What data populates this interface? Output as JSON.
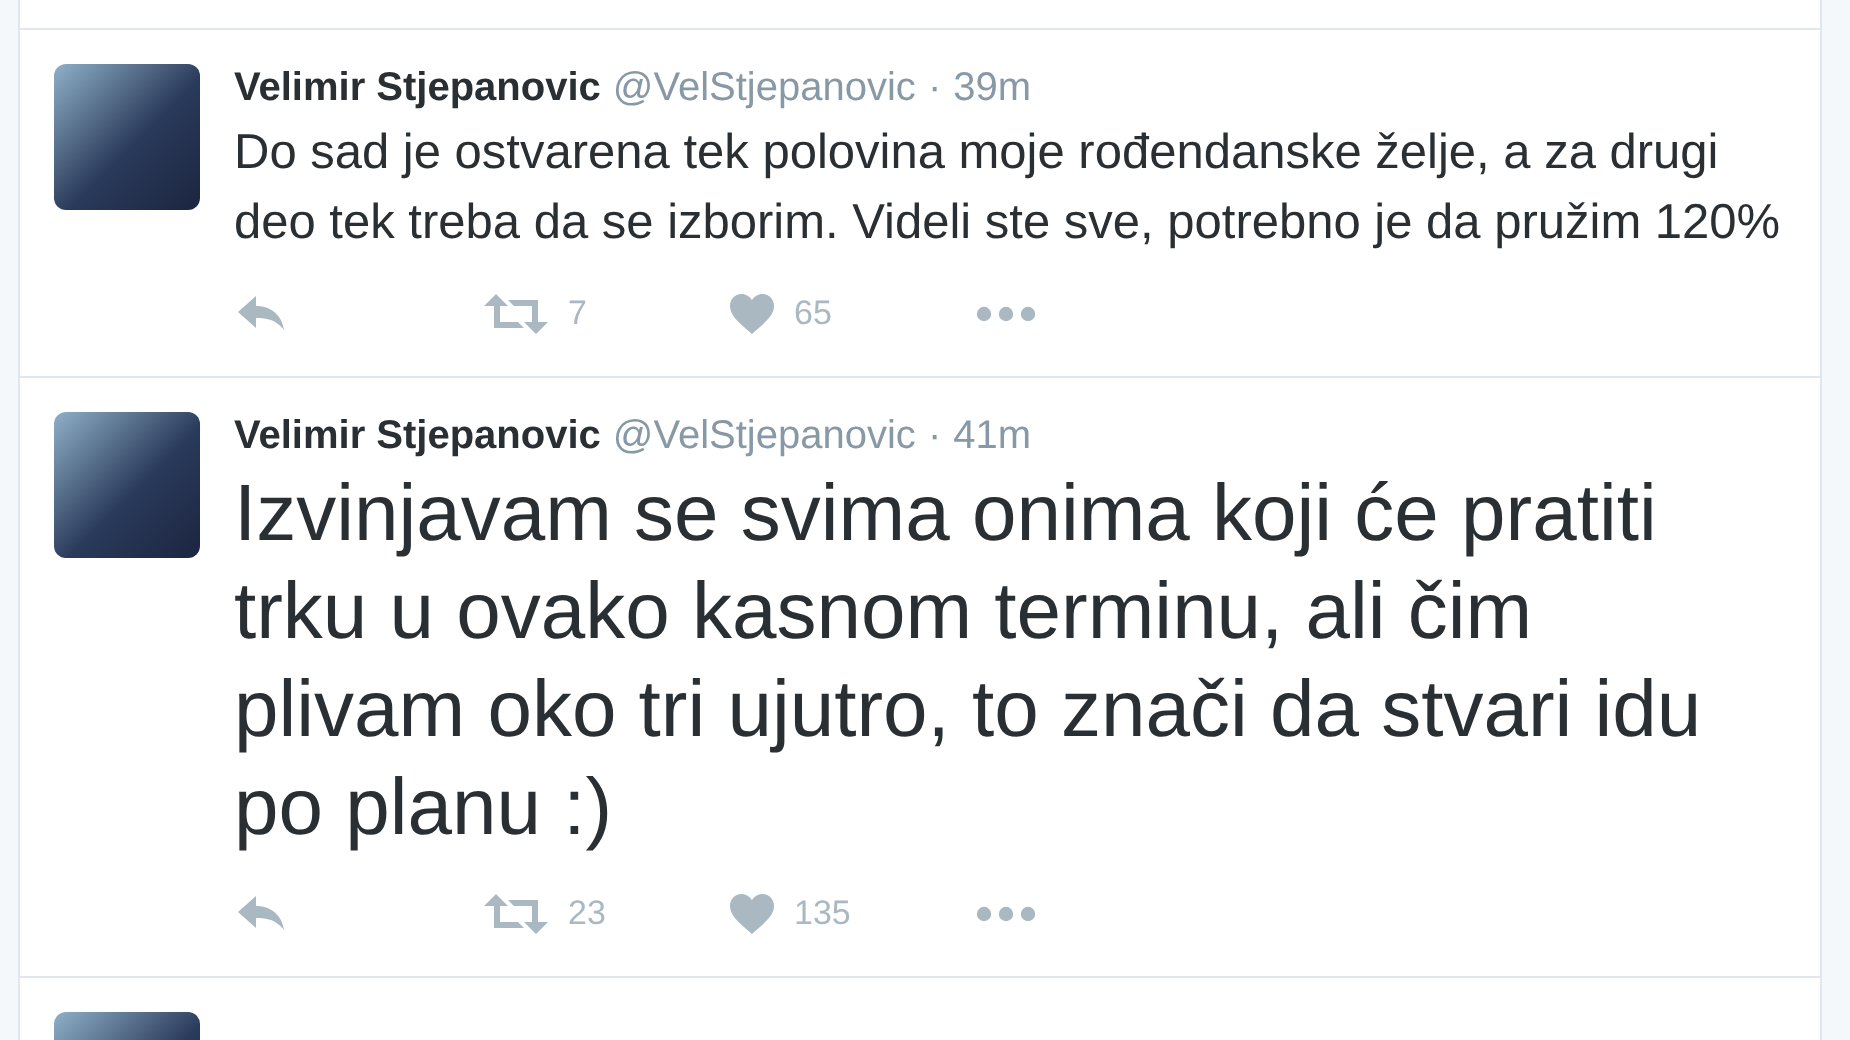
{
  "tweets": [
    {
      "name": "Velimir Stjepanovic",
      "handle": "@VelStjepanovic",
      "separator": "·",
      "time": "39m",
      "kind": "regular",
      "text": "Do sad je ostvarena tek polovina moje rođendanske želje, a za drugi deo tek treba da se izborim. Videli ste sve, potrebno je da pružim 120%",
      "retweets": "7",
      "likes": "65"
    },
    {
      "name": "Velimir Stjepanovic",
      "handle": "@VelStjepanovic",
      "separator": "·",
      "time": "41m",
      "kind": "large",
      "text": "Izvinjavam se svima onima koji će pratiti trku u ovako kasnom terminu, ali čim plivam oko tri ujutro, to znači da stvari idu po planu :)",
      "retweets": "23",
      "likes": "135"
    }
  ],
  "more_below": true
}
